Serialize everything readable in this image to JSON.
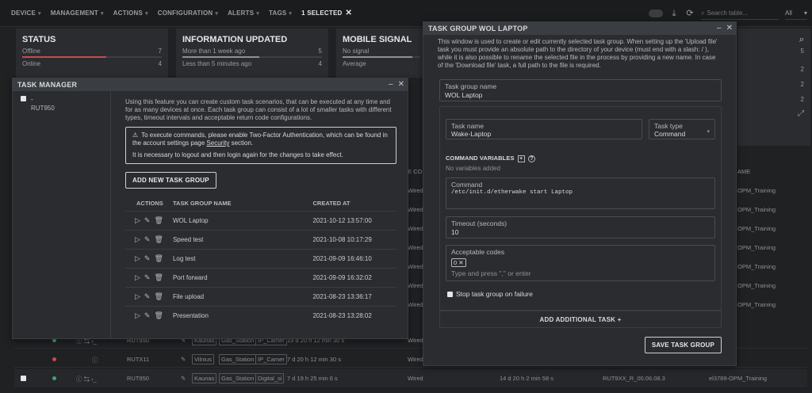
{
  "nav": {
    "items": [
      {
        "label": "DEVICE"
      },
      {
        "label": "MANAGEMENT"
      },
      {
        "label": "ACTIONS"
      },
      {
        "label": "CONFIGURATION"
      },
      {
        "label": "ALERTS"
      },
      {
        "label": "TAGS"
      }
    ],
    "selected_label": "1 SELECTED",
    "search_placeholder": "Search table...",
    "filter_value": "All"
  },
  "cards": {
    "status": {
      "title": "STATUS",
      "rows": [
        {
          "label": "Offline",
          "count": "7"
        },
        {
          "label": "Online",
          "count": "4"
        }
      ]
    },
    "info": {
      "title": "INFORMATION UPDATED",
      "rows": [
        {
          "label": "More than 1 week ago",
          "count": "5"
        },
        {
          "label": "Less than 5 minutes ago",
          "count": "4"
        }
      ]
    },
    "mobile": {
      "title": "MOBILE SIGNAL",
      "rows": [
        {
          "label": "No signal",
          "count": ""
        },
        {
          "label": "Average",
          "count": ""
        }
      ]
    },
    "right_counts": [
      "5",
      "2",
      "2",
      "2"
    ]
  },
  "background_table": {
    "col_partial": "E CON",
    "col_name_partial": "AME",
    "wired_label": "Wired",
    "training_label": "OPM_Training",
    "rows": [
      {
        "device": "RUT950",
        "tags": [
          "Kaunas",
          "Gas_Station",
          "IP_Camer"
        ],
        "uptime": "19 d 20 h 12 min 30 s",
        "conn": "Wired"
      },
      {
        "device": "RUTX11",
        "tags": [
          "Vilnius",
          "Gas_Station",
          "IP_Camer"
        ],
        "uptime": "7 d 20 h 12 min 30 s",
        "conn": "Wired"
      },
      {
        "device": "RUT950",
        "tags": [
          "Kaunas",
          "Gas_Station",
          "Digital_si"
        ],
        "uptime": "7 d 19 h 25 min 6 s",
        "conn": "Wired",
        "uptime2": "14 d 20 h 2 min 58 s",
        "firmware": "RUT9XX_R_00.06.08.3",
        "group": "el3789-OPM_Training"
      }
    ]
  },
  "task_manager": {
    "title": "TASK MANAGER",
    "side_device_dash": "-",
    "side_device": "RUT950",
    "intro": "Using this feature you can create custom task scenarios, that can be executed at any time and for as many devices at once. Each task group can consist of a lot of smaller tasks with different types, timeout intervals and acceptable return code configurations.",
    "warn_line1_pre": "To execute commands, please enable Two-Factor Authentication, which can be found in the account settings page",
    "warn_link": "Security",
    "warn_line1_post": "section.",
    "warn_line2": "It is necessary to logout and then login again for the changes to take effect.",
    "add_button": "ADD NEW TASK GROUP",
    "columns": {
      "actions": "ACTIONS",
      "name": "TASK GROUP NAME",
      "created": "CREATED AT"
    },
    "rows": [
      {
        "name": "WOL Laptop",
        "created": "2021-10-12 13:57:00"
      },
      {
        "name": "Speed test",
        "created": "2021-10-08 10:17:29"
      },
      {
        "name": "Log test",
        "created": "2021-09-09 16:46:10"
      },
      {
        "name": "Port forward",
        "created": "2021-09-09 16:32:02"
      },
      {
        "name": "File upload",
        "created": "2021-08-23 13:36:17"
      },
      {
        "name": "Presentation",
        "created": "2021-08-23 13:28:02"
      }
    ]
  },
  "task_group": {
    "title": "TASK GROUP WOL LAPTOP",
    "intro": "This window is used to create or edit currently selected task group. When setting up the 'Upload file' task you must provide an absolute path to the directory of your device (must end with a slash: / ), while it is also possible to rename the selected file in the process by providing a new name. In case of the 'Download file' task, a full path to the file is required.",
    "group_name_label": "Task group name",
    "group_name_value": "WOL Laptop",
    "task_name_label": "Task name",
    "task_name_value": "Wake-Laptop",
    "task_type_label": "Task type",
    "task_type_value": "Command",
    "cmd_vars_title": "COMMAND VARIABLES",
    "no_vars": "No variables added",
    "command_label": "Command",
    "command_value": "/etc/init.d/etherwake start Laptop",
    "timeout_label": "Timeout (seconds)",
    "timeout_value": "10",
    "codes_label": "Acceptable codes",
    "codes_chip": "0",
    "codes_placeholder": "Type and press \",\" or enter",
    "stop_label": "Stop task group on failure",
    "add_task": "ADD ADDITIONAL TASK +",
    "save": "SAVE TASK GROUP"
  }
}
